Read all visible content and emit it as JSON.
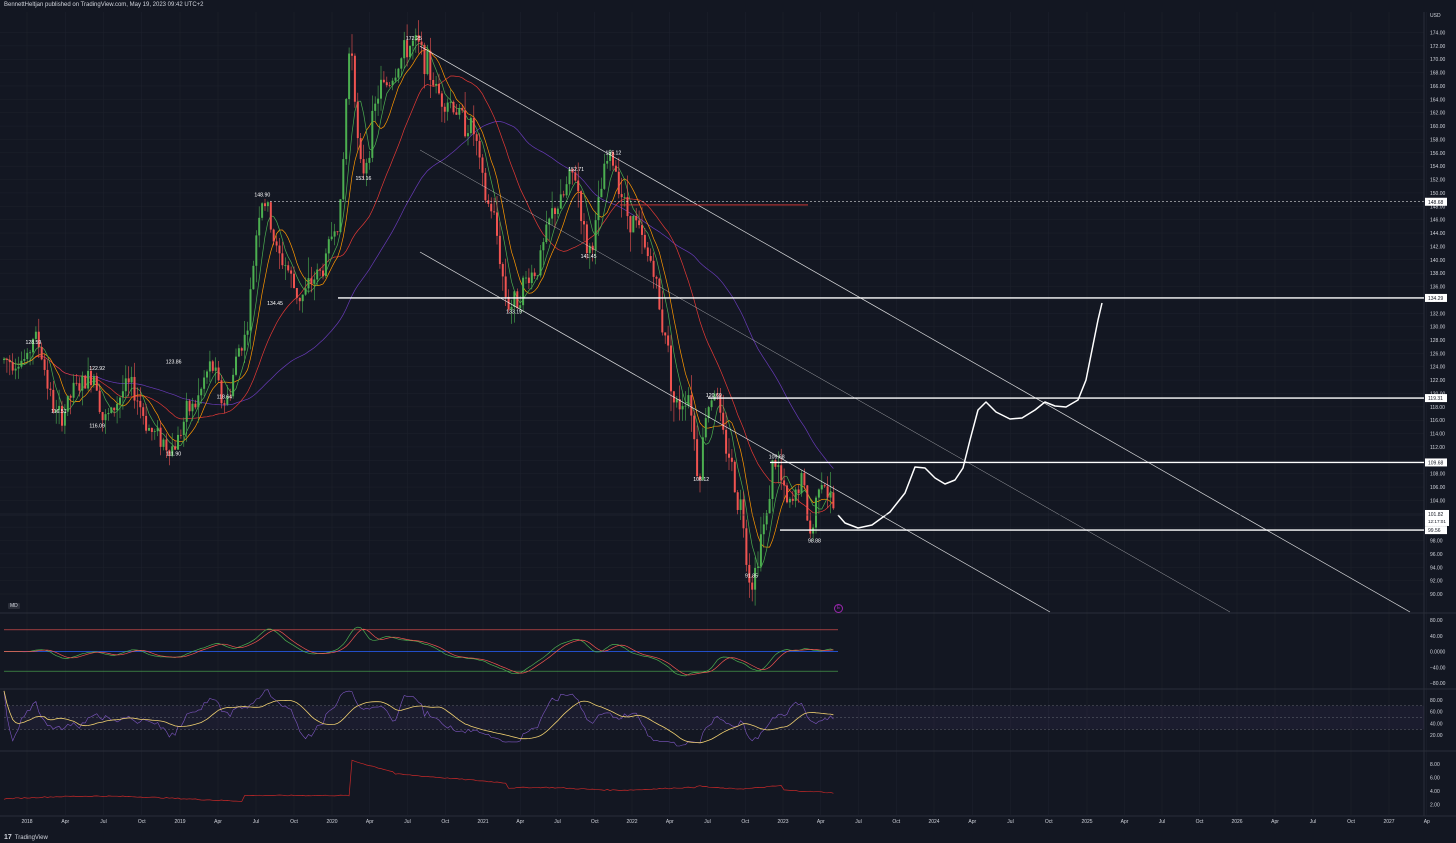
{
  "header": {
    "published_text": "BennettHeltjan published on TradingView.com, May 19, 2023 09:42 UTC+2"
  },
  "brand": {
    "name": "TradingView",
    "logo_icon": "tv-logo-icon"
  },
  "indicator_badge": "MD",
  "annotation_marker": "E",
  "colors": {
    "background": "#131722",
    "grid": "#1e222d",
    "up_candle": "#26a69a",
    "up_candle_bright": "#4caf50",
    "down_candle": "#ef5350",
    "ma_fast": "#4caf50",
    "ma_mid": "#ff9800",
    "ma_slow": "#e53935",
    "ma_long": "#673ab7",
    "drawing": "#ffffff",
    "osc_blue": "#2962ff",
    "rsi": "#7e57c2",
    "rsi_ma": "#f0d070",
    "vol_line": "#c62828"
  },
  "chart_data": {
    "type": "candlestick",
    "symbol_unit": "USD",
    "ylim": [
      88,
      176
    ],
    "price_axis": [
      "174.00",
      "172.00",
      "170.00",
      "168.00",
      "166.00",
      "164.00",
      "162.00",
      "160.00",
      "158.00",
      "156.00",
      "154.00",
      "152.00",
      "150.00",
      "148.00",
      "146.00",
      "144.00",
      "142.00",
      "140.00",
      "138.00",
      "136.00",
      "134.00",
      "132.00",
      "130.00",
      "128.00",
      "126.00",
      "124.00",
      "122.00",
      "120.00",
      "118.00",
      "116.00",
      "114.00",
      "112.00",
      "110.00",
      "108.00",
      "106.00",
      "104.00",
      "102.00",
      "100.00",
      "98.00",
      "96.00",
      "94.00",
      "92.00",
      "90.00"
    ],
    "time_axis": [
      "2018",
      "Apr",
      "Jul",
      "Oct",
      "2019",
      "Apr",
      "Jul",
      "Oct",
      "2020",
      "Apr",
      "Jul",
      "Oct",
      "2021",
      "Apr",
      "Jul",
      "Oct",
      "2022",
      "Apr",
      "Jul",
      "Oct",
      "2023",
      "Apr",
      "Jul",
      "Oct",
      "2024",
      "Apr",
      "Jul",
      "Oct",
      "2025",
      "Apr",
      "Jul",
      "Oct",
      "2026",
      "Apr",
      "Jul",
      "Oct",
      "2027",
      "Ap"
    ],
    "price_labels": [
      {
        "label": "128.59",
        "date": "2018-01",
        "price": 128.59
      },
      {
        "label": "116.51",
        "date": "2018-03",
        "price": 116.51
      },
      {
        "label": "122.92",
        "date": "2018-06",
        "price": 122.92
      },
      {
        "label": "116.09",
        "date": "2018-06",
        "price": 116.09
      },
      {
        "label": "111.90",
        "date": "2018-12",
        "price": 111.9
      },
      {
        "label": "123.86",
        "date": "2018-12",
        "price": 123.86
      },
      {
        "label": "118.64",
        "date": "2019-04",
        "price": 118.64
      },
      {
        "label": "148.90",
        "date": "2019-07",
        "price": 148.9
      },
      {
        "label": "134.45",
        "date": "2019-08",
        "price": 134.45
      },
      {
        "label": "153.16",
        "date": "2020-03",
        "price": 153.16
      },
      {
        "label": "172.25",
        "date": "2020-07",
        "price": 172.25
      },
      {
        "label": "133.19",
        "date": "2021-03",
        "price": 133.19
      },
      {
        "label": "141.45",
        "date": "2021-09",
        "price": 141.45
      },
      {
        "label": "152.71",
        "date": "2021-08",
        "price": 152.71
      },
      {
        "label": "155.12",
        "date": "2021-11",
        "price": 155.12
      },
      {
        "label": "120.69",
        "date": "2022-07",
        "price": 120.69
      },
      {
        "label": "108.12",
        "date": "2022-06",
        "price": 108.12
      },
      {
        "label": "91.85",
        "date": "2022-10",
        "price": 91.85
      },
      {
        "label": "109.68",
        "date": "2022-12",
        "price": 109.68
      },
      {
        "label": "98.88",
        "date": "2023-03",
        "price": 98.88
      }
    ],
    "horizontal_levels": [
      {
        "label": "148.68",
        "price": 148.68,
        "style": "dashed"
      },
      {
        "label": "134.29",
        "price": 134.29,
        "style": "solid"
      },
      {
        "label": "119.31",
        "price": 119.31,
        "style": "solid"
      },
      {
        "label": "109.68",
        "price": 109.68,
        "style": "solid"
      },
      {
        "label": "99.56",
        "price": 99.56,
        "style": "solid"
      }
    ],
    "current_price": {
      "label": "101.82",
      "countdown": "12:17:01",
      "price": 101.82
    },
    "oscillator_axis": [
      "80.00",
      "40.00",
      "0.0000",
      "−40.00",
      "−80.00"
    ],
    "rsi_axis": [
      "80.00",
      "60.00",
      "40.00",
      "20.00"
    ],
    "volatility_axis": [
      "8.00",
      "6.00",
      "4.00",
      "2.00"
    ]
  }
}
